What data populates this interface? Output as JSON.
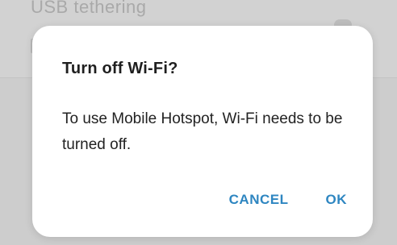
{
  "background": {
    "row_title": "USB tethering"
  },
  "dialog": {
    "title": "Turn off Wi-Fi?",
    "message": "To use Mobile Hotspot, Wi-Fi needs to be turned off.",
    "cancel_label": "CANCEL",
    "ok_label": "OK"
  },
  "colors": {
    "accent": "#2e86c1",
    "dialog_bg": "#ffffff",
    "scrim": "#cdcdcd"
  }
}
